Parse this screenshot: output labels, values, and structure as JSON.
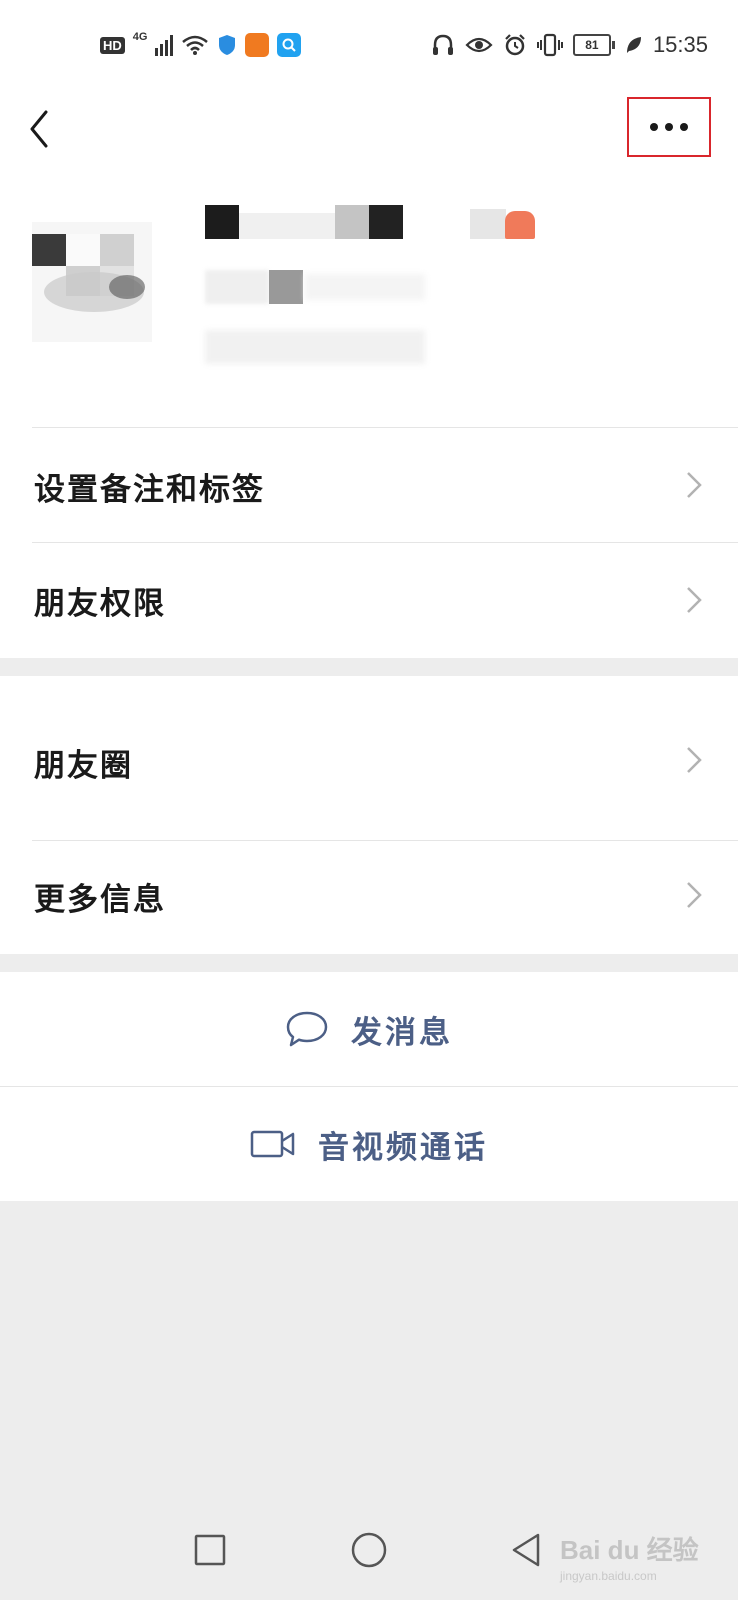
{
  "status_bar": {
    "hd": "HD",
    "network": "4G",
    "battery": "81",
    "time": "15:35"
  },
  "header": {
    "back_icon": "chevron-left-icon",
    "more_icon": "more-dots-icon",
    "highlight_color": "#d9262c"
  },
  "menu_group_1": [
    {
      "label": "设置备注和标签"
    },
    {
      "label": "朋友权限"
    }
  ],
  "menu_group_2": [
    {
      "label": "朋友圈"
    },
    {
      "label": "更多信息"
    }
  ],
  "actions": {
    "message": {
      "label": "发消息",
      "icon": "chat-bubble-icon"
    },
    "call": {
      "label": "音视频通话",
      "icon": "video-camera-icon"
    },
    "accent_color": "#4c5f86"
  },
  "nav": {
    "recents_icon": "square-icon",
    "home_icon": "circle-icon",
    "back_icon": "triangle-back-icon"
  },
  "watermark": {
    "brand": "Bai du 经验",
    "site": "jingyan.baidu.com"
  }
}
